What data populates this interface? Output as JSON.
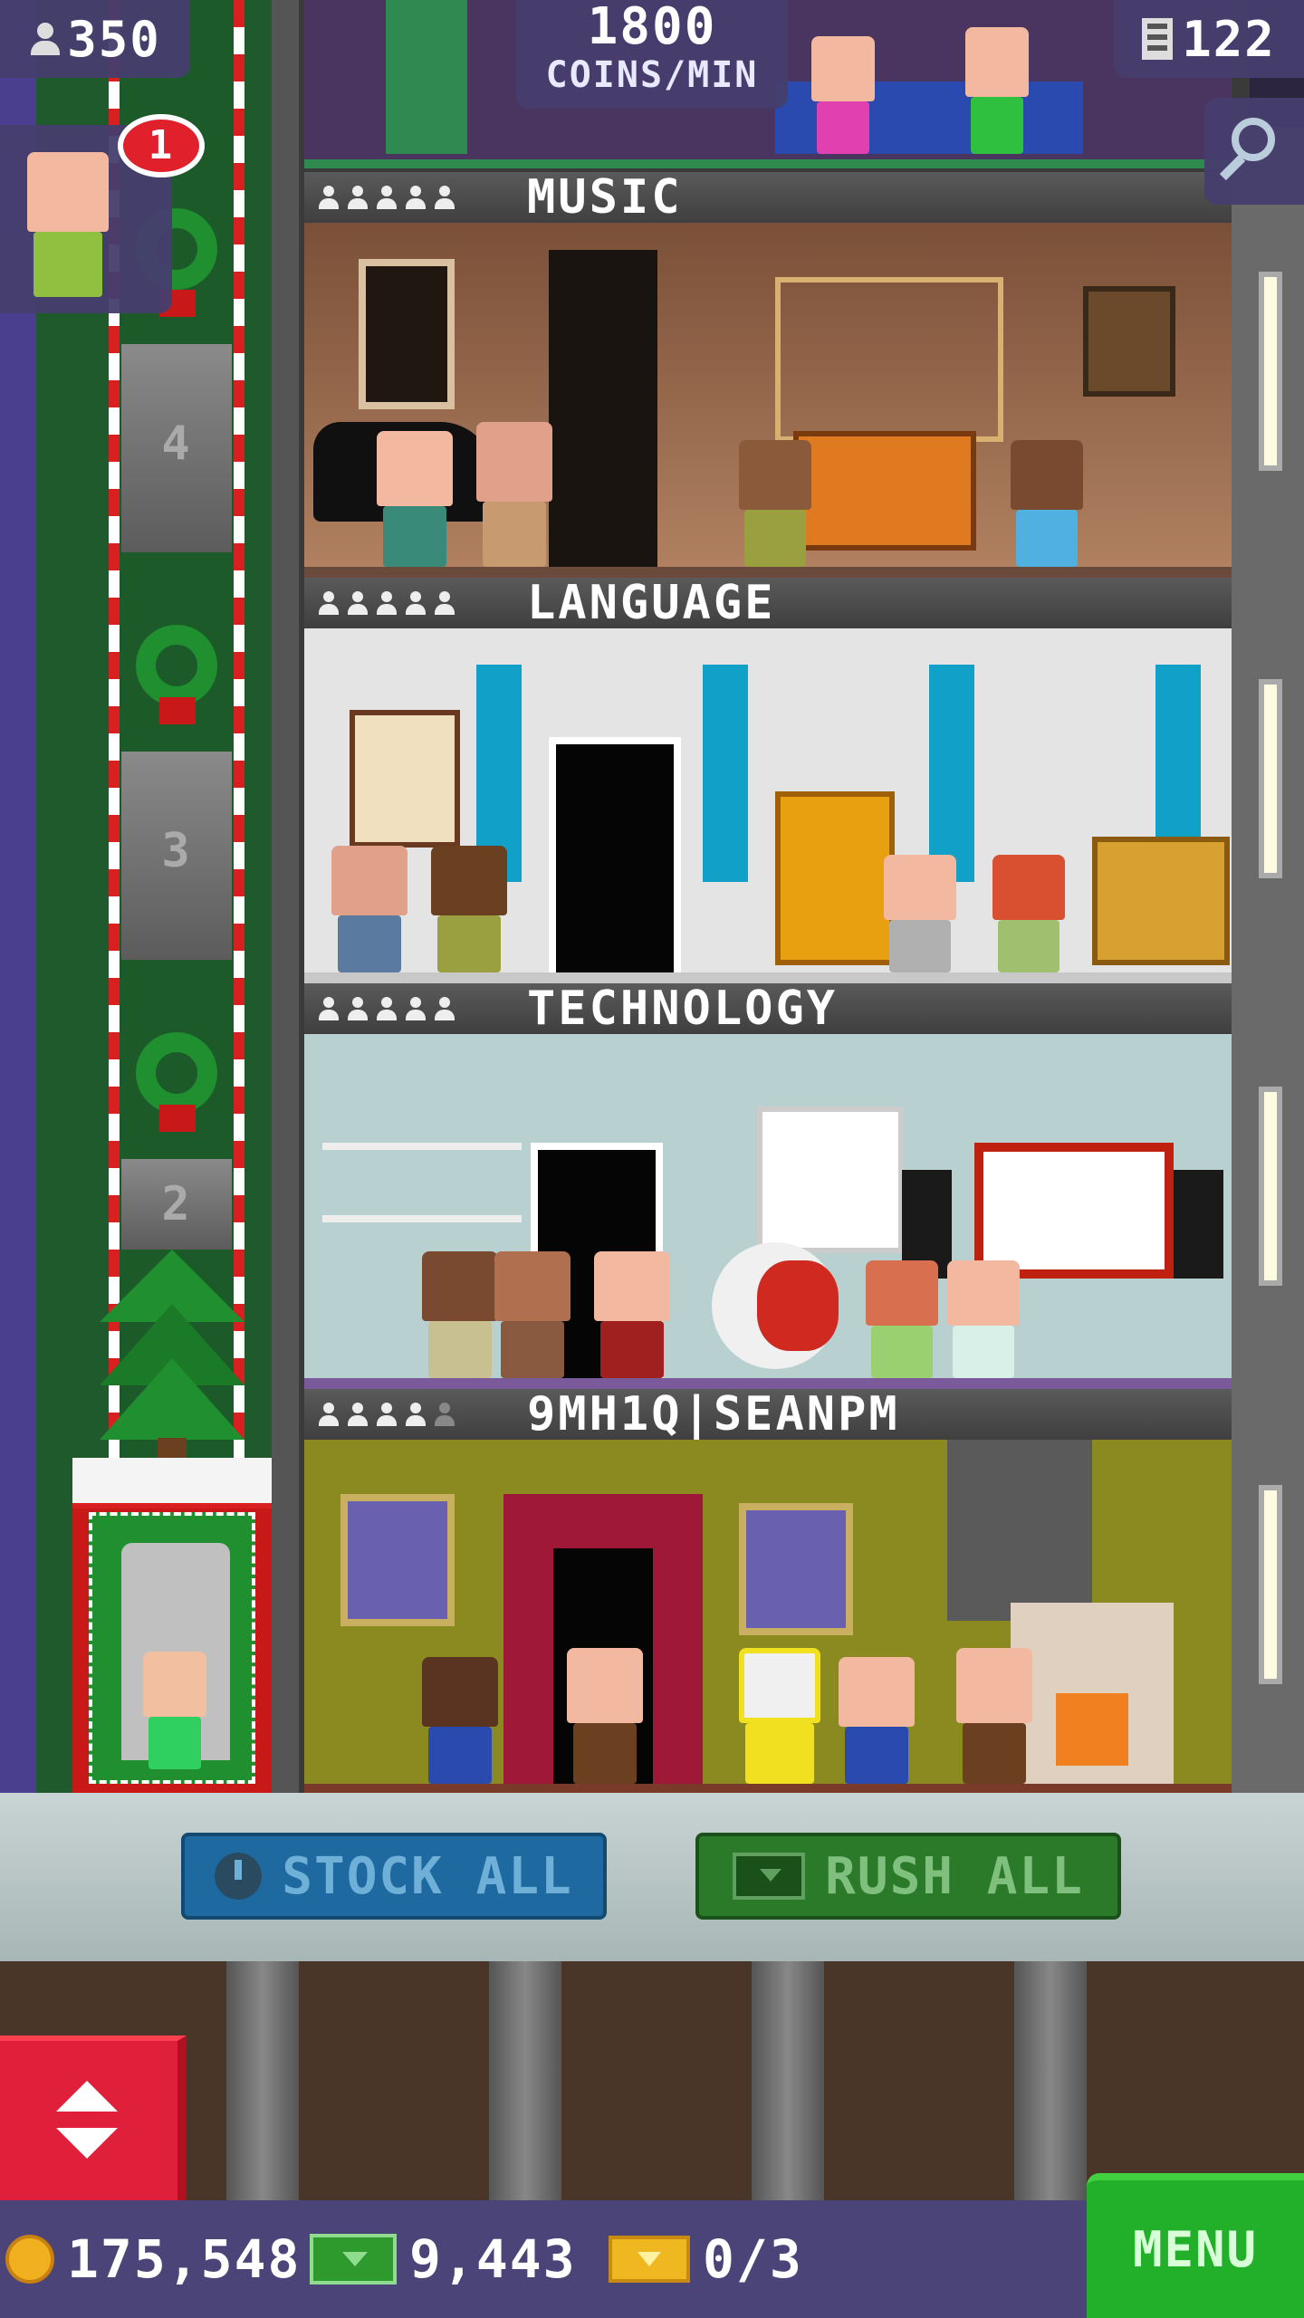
{
  "hud": {
    "population": "350",
    "coins_per_min_value": "1800",
    "coins_per_min_label": "COINS/MIN",
    "floor_count": "122",
    "visitor_badge": "1"
  },
  "floors": [
    {
      "name": "MUSIC",
      "stars_filled": 5
    },
    {
      "name": "LANGUAGE",
      "stars_filled": 5
    },
    {
      "name": "TECHNOLOGY",
      "stars_filled": 5
    },
    {
      "name": "9MH1Q|SEANPM",
      "stars_filled": 4
    }
  ],
  "elevator": {
    "shaft_numbers": [
      "4",
      "3",
      "2"
    ]
  },
  "actions": {
    "stock_all": "STOCK ALL",
    "rush_all": "RUSH ALL"
  },
  "bottom_hud": {
    "coins": "175,548",
    "tower_bux": "9,443",
    "tickets": "0/3",
    "menu": "MENU"
  },
  "colors": {
    "hud_panel": "#463e6e",
    "stock_button": "#1e6aa0",
    "rush_button": "#2a7a2a",
    "menu_button": "#22b02a",
    "elevator_button": "#e0203a"
  }
}
